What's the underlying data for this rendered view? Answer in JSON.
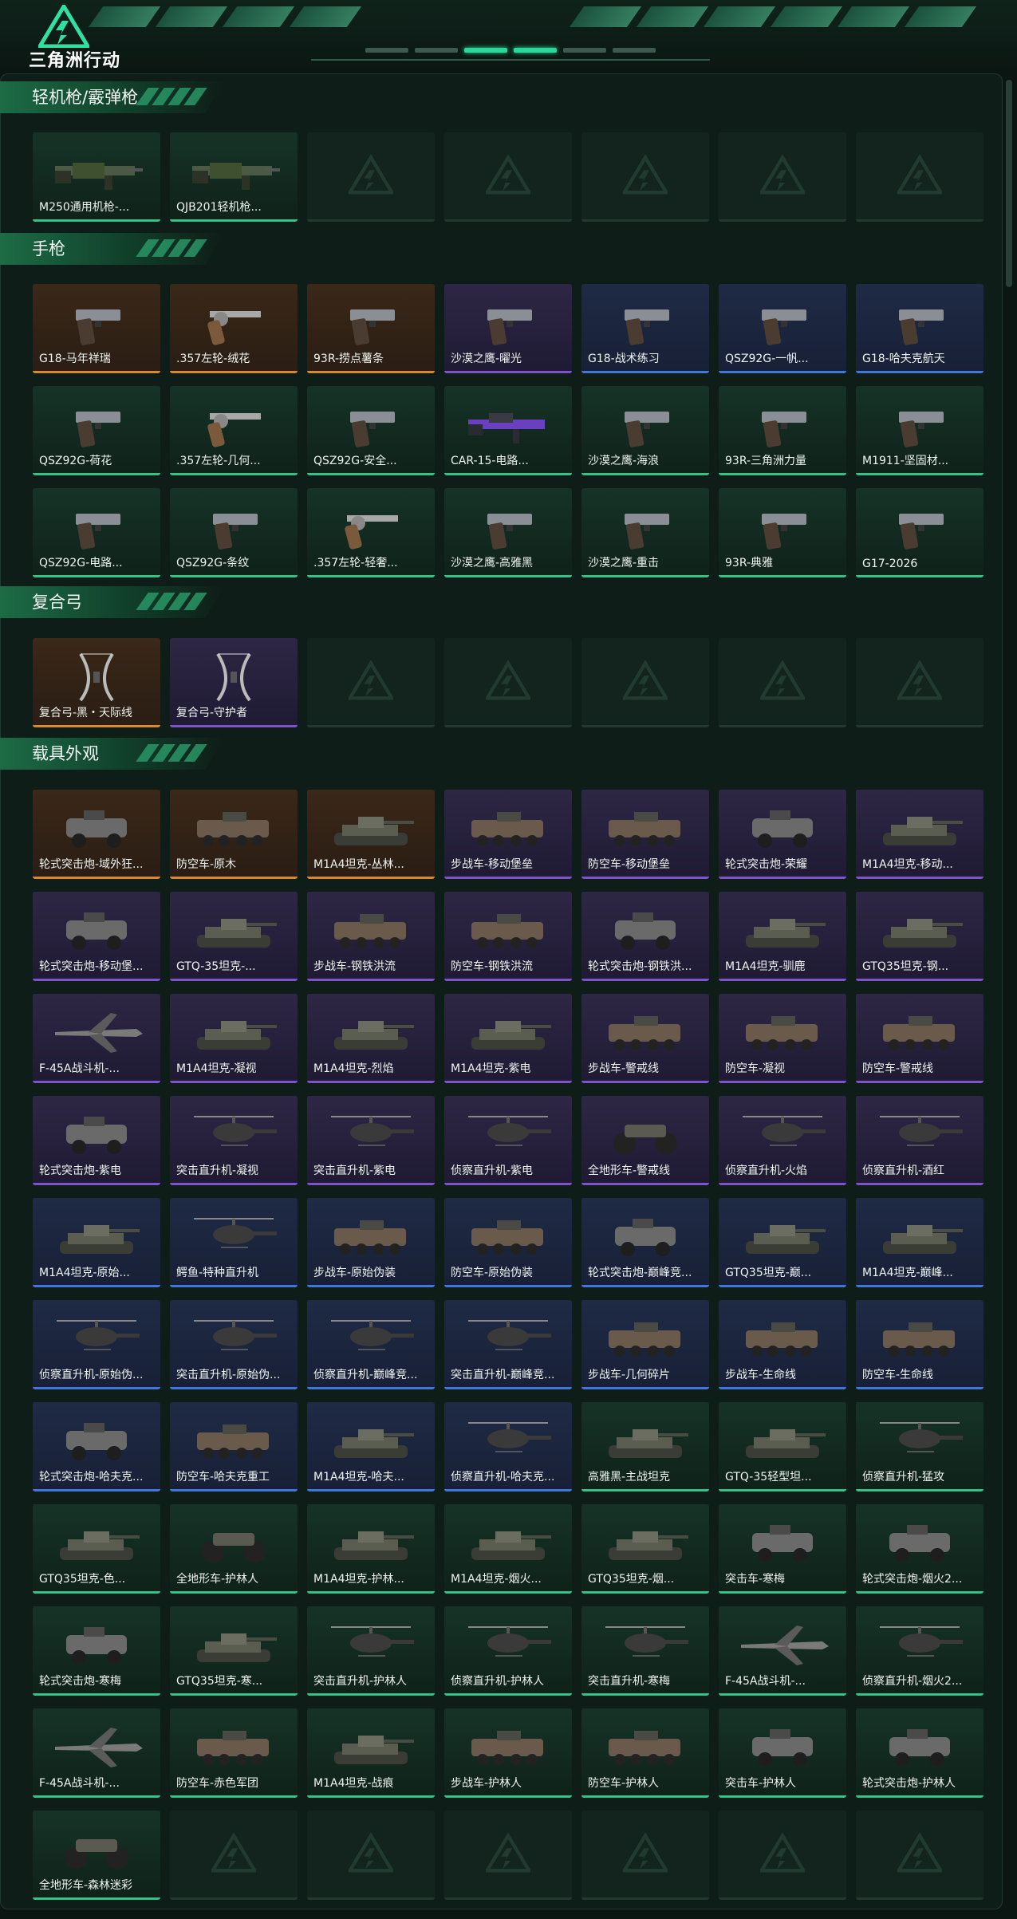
{
  "brand": {
    "name": "三角洲行动"
  },
  "sections": [
    {
      "title": "轻机枪/霰弹枪",
      "cards": [
        {
          "label": "M250通用机枪-...",
          "rarity": "green",
          "icon": "weapon-lmg-icon"
        },
        {
          "label": "QJB201轻机枪...",
          "rarity": "green",
          "icon": "weapon-lmg-icon"
        },
        {
          "label": "",
          "rarity": "empty"
        },
        {
          "label": "",
          "rarity": "empty"
        },
        {
          "label": "",
          "rarity": "empty"
        },
        {
          "label": "",
          "rarity": "empty"
        },
        {
          "label": "",
          "rarity": "empty"
        }
      ]
    },
    {
      "title": "手枪",
      "cards": [
        {
          "label": "G18-马年祥瑞",
          "rarity": "gold",
          "icon": "pistol-icon"
        },
        {
          "label": ".357左轮-绒花",
          "rarity": "gold",
          "icon": "revolver-icon"
        },
        {
          "label": "93R-捞点薯条",
          "rarity": "gold",
          "icon": "pistol-icon"
        },
        {
          "label": "沙漠之鹰-曜光",
          "rarity": "purple",
          "icon": "pistol-icon"
        },
        {
          "label": "G18-战术练习",
          "rarity": "blue",
          "icon": "pistol-icon"
        },
        {
          "label": "QSZ92G-一帆...",
          "rarity": "blue",
          "icon": "pistol-icon"
        },
        {
          "label": "G18-哈夫克航天",
          "rarity": "blue",
          "icon": "pistol-icon"
        },
        {
          "label": "QSZ92G-荷花",
          "rarity": "green",
          "icon": "pistol-icon"
        },
        {
          "label": ".357左轮-几何...",
          "rarity": "green",
          "icon": "revolver-icon"
        },
        {
          "label": "QSZ92G-安全...",
          "rarity": "green",
          "icon": "pistol-icon"
        },
        {
          "label": "CAR-15-电路...",
          "rarity": "green",
          "icon": "rifle-icon"
        },
        {
          "label": "沙漠之鹰-海浪",
          "rarity": "green",
          "icon": "pistol-icon"
        },
        {
          "label": "93R-三角洲力量",
          "rarity": "green",
          "icon": "pistol-icon"
        },
        {
          "label": "M1911-坚固材...",
          "rarity": "green",
          "icon": "pistol-icon"
        },
        {
          "label": "QSZ92G-电路...",
          "rarity": "green",
          "icon": "pistol-icon"
        },
        {
          "label": "QSZ92G-条纹",
          "rarity": "green",
          "icon": "pistol-icon"
        },
        {
          "label": ".357左轮-轻奢...",
          "rarity": "green",
          "icon": "revolver-icon"
        },
        {
          "label": "沙漠之鹰-高雅黑",
          "rarity": "green",
          "icon": "pistol-icon"
        },
        {
          "label": "沙漠之鹰-重击",
          "rarity": "green",
          "icon": "pistol-icon"
        },
        {
          "label": "93R-典雅",
          "rarity": "green",
          "icon": "pistol-icon"
        },
        {
          "label": "G17-2026",
          "rarity": "green",
          "icon": "pistol-icon"
        }
      ]
    },
    {
      "title": "复合弓",
      "cards": [
        {
          "label": "复合弓-黑・天际线",
          "rarity": "gold",
          "icon": "bow-icon"
        },
        {
          "label": "复合弓-守护者",
          "rarity": "purple",
          "icon": "bow-icon"
        },
        {
          "label": "",
          "rarity": "empty"
        },
        {
          "label": "",
          "rarity": "empty"
        },
        {
          "label": "",
          "rarity": "empty"
        },
        {
          "label": "",
          "rarity": "empty"
        },
        {
          "label": "",
          "rarity": "empty"
        }
      ]
    },
    {
      "title": "载具外观",
      "cards": [
        {
          "label": "轮式突击炮-域外狂...",
          "rarity": "gold",
          "icon": "armored-car-icon"
        },
        {
          "label": "防空车-原木",
          "rarity": "gold",
          "icon": "apc-icon"
        },
        {
          "label": "M1A4坦克-丛林...",
          "rarity": "gold",
          "icon": "tank-icon"
        },
        {
          "label": "步战车-移动堡垒",
          "rarity": "purple",
          "icon": "apc-icon"
        },
        {
          "label": "防空车-移动堡垒",
          "rarity": "purple",
          "icon": "apc-icon"
        },
        {
          "label": "轮式突击炮-荣耀",
          "rarity": "purple",
          "icon": "armored-car-icon"
        },
        {
          "label": "M1A4坦克-移动...",
          "rarity": "purple",
          "icon": "tank-icon"
        },
        {
          "label": "轮式突击炮-移动堡...",
          "rarity": "purple",
          "icon": "armored-car-icon"
        },
        {
          "label": "GTQ-35坦克-...",
          "rarity": "purple",
          "icon": "tank-icon"
        },
        {
          "label": "步战车-钢铁洪流",
          "rarity": "purple",
          "icon": "apc-icon"
        },
        {
          "label": "防空车-钢铁洪流",
          "rarity": "purple",
          "icon": "apc-icon"
        },
        {
          "label": "轮式突击炮-钢铁洪...",
          "rarity": "purple",
          "icon": "armored-car-icon"
        },
        {
          "label": "M1A4坦克-驯鹿",
          "rarity": "purple",
          "icon": "tank-icon"
        },
        {
          "label": "GTQ35坦克-钢...",
          "rarity": "purple",
          "icon": "tank-icon"
        },
        {
          "label": "F-45A战斗机-...",
          "rarity": "purple",
          "icon": "jet-icon"
        },
        {
          "label": "M1A4坦克-凝视",
          "rarity": "purple",
          "icon": "tank-icon"
        },
        {
          "label": "M1A4坦克-烈焰",
          "rarity": "purple",
          "icon": "tank-icon"
        },
        {
          "label": "M1A4坦克-紫电",
          "rarity": "purple",
          "icon": "tank-icon"
        },
        {
          "label": "步战车-警戒线",
          "rarity": "purple",
          "icon": "apc-icon"
        },
        {
          "label": "防空车-凝视",
          "rarity": "purple",
          "icon": "apc-icon"
        },
        {
          "label": "防空车-警戒线",
          "rarity": "purple",
          "icon": "apc-icon"
        },
        {
          "label": "轮式突击炮-紫电",
          "rarity": "purple",
          "icon": "armored-car-icon"
        },
        {
          "label": "突击直升机-凝视",
          "rarity": "purple",
          "icon": "helicopter-icon"
        },
        {
          "label": "突击直升机-紫电",
          "rarity": "purple",
          "icon": "helicopter-icon"
        },
        {
          "label": "侦察直升机-紫电",
          "rarity": "purple",
          "icon": "helicopter-icon"
        },
        {
          "label": "全地形车-警戒线",
          "rarity": "purple",
          "icon": "atv-icon"
        },
        {
          "label": "侦察直升机-火焰",
          "rarity": "purple",
          "icon": "helicopter-icon"
        },
        {
          "label": "侦察直升机-酒红",
          "rarity": "purple",
          "icon": "helicopter-icon"
        },
        {
          "label": "M1A4坦克-原始...",
          "rarity": "blue",
          "icon": "tank-icon"
        },
        {
          "label": "鳄鱼-特种直升机",
          "rarity": "blue",
          "icon": "helicopter-icon"
        },
        {
          "label": "步战车-原始伪装",
          "rarity": "blue",
          "icon": "apc-icon"
        },
        {
          "label": "防空车-原始伪装",
          "rarity": "blue",
          "icon": "apc-icon"
        },
        {
          "label": "轮式突击炮-巅峰竞...",
          "rarity": "blue",
          "icon": "armored-car-icon"
        },
        {
          "label": "GTQ35坦克-巅...",
          "rarity": "blue",
          "icon": "tank-icon"
        },
        {
          "label": "M1A4坦克-巅峰...",
          "rarity": "blue",
          "icon": "tank-icon"
        },
        {
          "label": "侦察直升机-原始伪...",
          "rarity": "blue",
          "icon": "helicopter-icon"
        },
        {
          "label": "突击直升机-原始伪...",
          "rarity": "blue",
          "icon": "helicopter-icon"
        },
        {
          "label": "侦察直升机-巅峰竞...",
          "rarity": "blue",
          "icon": "helicopter-icon"
        },
        {
          "label": "突击直升机-巅峰竞...",
          "rarity": "blue",
          "icon": "helicopter-icon"
        },
        {
          "label": "步战车-几何碎片",
          "rarity": "blue",
          "icon": "apc-icon"
        },
        {
          "label": "步战车-生命线",
          "rarity": "blue",
          "icon": "apc-icon"
        },
        {
          "label": "防空车-生命线",
          "rarity": "blue",
          "icon": "apc-icon"
        },
        {
          "label": "轮式突击炮-哈夫克...",
          "rarity": "blue",
          "icon": "armored-car-icon"
        },
        {
          "label": "防空车-哈夫克重工",
          "rarity": "blue",
          "icon": "apc-icon"
        },
        {
          "label": "M1A4坦克-哈夫...",
          "rarity": "blue",
          "icon": "tank-icon"
        },
        {
          "label": "侦察直升机-哈夫克...",
          "rarity": "blue",
          "icon": "helicopter-icon"
        },
        {
          "label": "高雅黑-主战坦克",
          "rarity": "green",
          "icon": "tank-icon"
        },
        {
          "label": "GTQ-35轻型坦...",
          "rarity": "green",
          "icon": "tank-icon"
        },
        {
          "label": "侦察直升机-猛攻",
          "rarity": "green",
          "icon": "helicopter-icon"
        },
        {
          "label": "GTQ35坦克-色...",
          "rarity": "green",
          "icon": "tank-icon"
        },
        {
          "label": "全地形车-护林人",
          "rarity": "green",
          "icon": "atv-icon"
        },
        {
          "label": "M1A4坦克-护林...",
          "rarity": "green",
          "icon": "tank-icon"
        },
        {
          "label": "M1A4坦克-烟火...",
          "rarity": "green",
          "icon": "tank-icon"
        },
        {
          "label": "GTQ35坦克-烟...",
          "rarity": "green",
          "icon": "tank-icon"
        },
        {
          "label": "突击车-寒梅",
          "rarity": "green",
          "icon": "armored-car-icon"
        },
        {
          "label": "轮式突击炮-烟火2...",
          "rarity": "green",
          "icon": "armored-car-icon"
        },
        {
          "label": "轮式突击炮-寒梅",
          "rarity": "green",
          "icon": "armored-car-icon"
        },
        {
          "label": "GTQ35坦克-寒...",
          "rarity": "green",
          "icon": "tank-icon"
        },
        {
          "label": "突击直升机-护林人",
          "rarity": "green",
          "icon": "helicopter-icon"
        },
        {
          "label": "侦察直升机-护林人",
          "rarity": "green",
          "icon": "helicopter-icon"
        },
        {
          "label": "突击直升机-寒梅",
          "rarity": "green",
          "icon": "helicopter-icon"
        },
        {
          "label": "F-45A战斗机-...",
          "rarity": "green",
          "icon": "jet-icon"
        },
        {
          "label": "侦察直升机-烟火2...",
          "rarity": "green",
          "icon": "helicopter-icon"
        },
        {
          "label": "F-45A战斗机-...",
          "rarity": "green",
          "icon": "jet-icon"
        },
        {
          "label": "防空车-赤色军团",
          "rarity": "green",
          "icon": "apc-icon"
        },
        {
          "label": "M1A4坦克-战痕",
          "rarity": "green",
          "icon": "tank-icon"
        },
        {
          "label": "步战车-护林人",
          "rarity": "green",
          "icon": "apc-icon"
        },
        {
          "label": "防空车-护林人",
          "rarity": "green",
          "icon": "apc-icon"
        },
        {
          "label": "突击车-护林人",
          "rarity": "green",
          "icon": "armored-car-icon"
        },
        {
          "label": "轮式突击炮-护林人",
          "rarity": "green",
          "icon": "armored-car-icon"
        },
        {
          "label": "全地形车-森林迷彩",
          "rarity": "green",
          "icon": "atv-icon"
        },
        {
          "label": "",
          "rarity": "empty"
        },
        {
          "label": "",
          "rarity": "empty"
        },
        {
          "label": "",
          "rarity": "empty"
        },
        {
          "label": "",
          "rarity": "empty"
        },
        {
          "label": "",
          "rarity": "empty"
        },
        {
          "label": "",
          "rarity": "empty"
        }
      ]
    }
  ],
  "colors": {
    "gold": "#d88a2a",
    "purple": "#7e52c9",
    "blue": "#3f78d8",
    "green": "#2fc586",
    "accent": "#2bd89b"
  }
}
